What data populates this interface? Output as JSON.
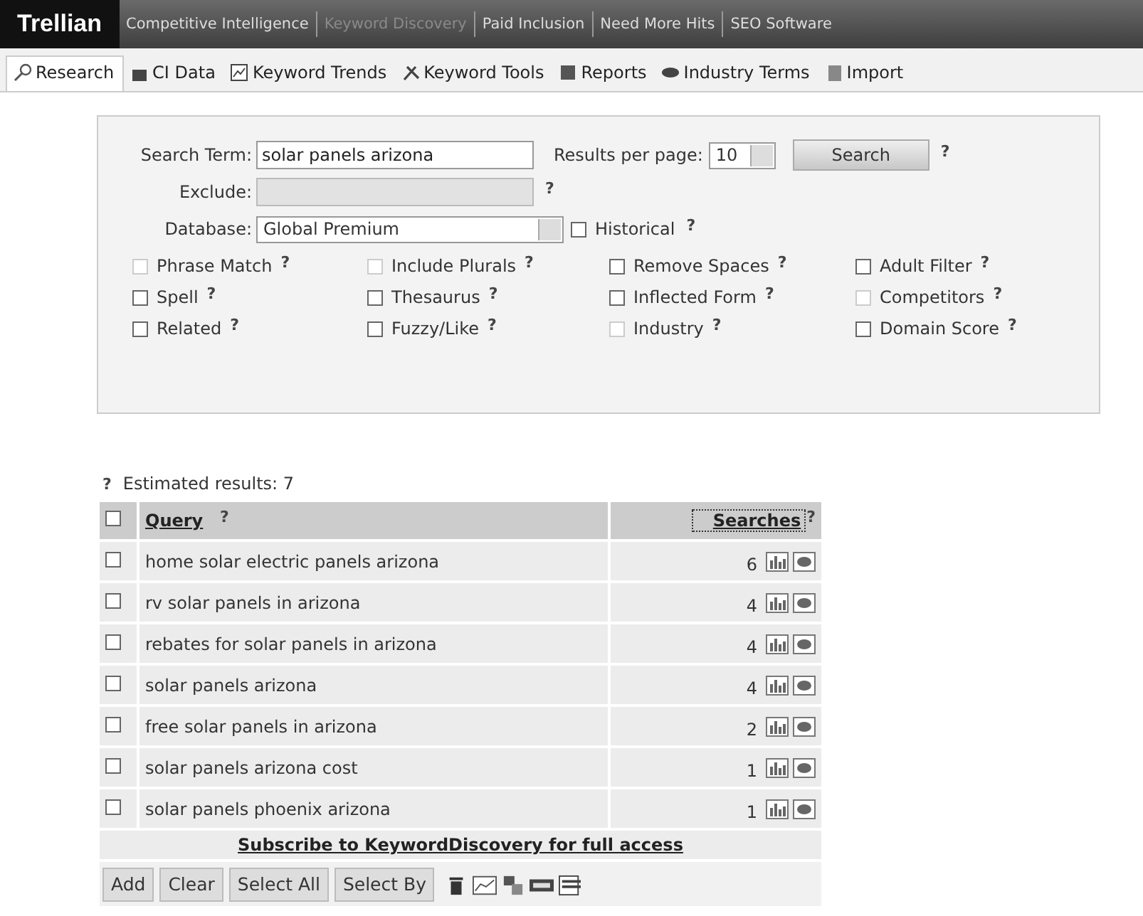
{
  "brand": "Trellian",
  "top_tabs": [
    {
      "label": "Competitive Intelligence",
      "selected": false
    },
    {
      "label": "Keyword Discovery",
      "selected": true
    },
    {
      "label": "Paid Inclusion",
      "selected": false
    },
    {
      "label": "Need More Hits",
      "selected": false
    },
    {
      "label": "SEO Software",
      "selected": false
    }
  ],
  "toolbar": [
    {
      "label": "Research",
      "selected": true
    },
    {
      "label": "CI Data",
      "selected": false
    },
    {
      "label": "Keyword Trends",
      "selected": false
    },
    {
      "label": "Keyword Tools",
      "selected": false
    },
    {
      "label": "Reports",
      "selected": false
    },
    {
      "label": "Industry Terms",
      "selected": false
    },
    {
      "label": "Import",
      "selected": false
    }
  ],
  "search": {
    "term_label": "Search Term:",
    "term_value": "solar panels arizona",
    "results_label": "Results per page:",
    "results_value": "10",
    "search_button": "Search",
    "exclude_label": "Exclude:",
    "database_label": "Database:",
    "database_value": "Global Premium",
    "historical": {
      "label": "Historical",
      "checked": false
    },
    "help": "?"
  },
  "options": [
    {
      "label": "Phrase Match",
      "checked": false,
      "disabled": true
    },
    {
      "label": "Include Plurals",
      "checked": false,
      "disabled": true
    },
    {
      "label": "Remove Spaces",
      "checked": false,
      "disabled": false
    },
    {
      "label": "Adult Filter",
      "checked": false,
      "disabled": false
    },
    {
      "label": "Spell",
      "checked": false,
      "disabled": false
    },
    {
      "label": "Thesaurus",
      "checked": false,
      "disabled": false
    },
    {
      "label": "Inflected Form",
      "checked": false,
      "disabled": false
    },
    {
      "label": "Competitors",
      "checked": false,
      "disabled": true
    },
    {
      "label": "Related",
      "checked": false,
      "disabled": false
    },
    {
      "label": "Fuzzy/Like",
      "checked": false,
      "disabled": false
    },
    {
      "label": "Industry",
      "checked": false,
      "disabled": true
    },
    {
      "label": "Domain Score",
      "checked": false,
      "disabled": false
    }
  ],
  "estimated": "Estimated results: 7",
  "table": {
    "columns": [
      "Query",
      "Searches"
    ],
    "all_checked": false,
    "rows": [
      {
        "query": "home solar electric panels arizona",
        "searches": "6",
        "checked": false
      },
      {
        "query": "rv solar panels in arizona",
        "searches": "4",
        "checked": false
      },
      {
        "query": "rebates for solar panels in arizona",
        "searches": "4",
        "checked": false
      },
      {
        "query": "solar panels arizona",
        "searches": "4",
        "checked": false
      },
      {
        "query": "free solar panels in arizona",
        "searches": "2",
        "checked": false
      },
      {
        "query": "solar panels arizona cost",
        "searches": "1",
        "checked": false
      },
      {
        "query": "solar panels phoenix arizona",
        "searches": "1",
        "checked": false
      }
    ],
    "subscribe": "Subscribe to KeywordDiscovery for full access"
  },
  "buttons": [
    "Add",
    "Clear",
    "Select All",
    "Select By"
  ]
}
